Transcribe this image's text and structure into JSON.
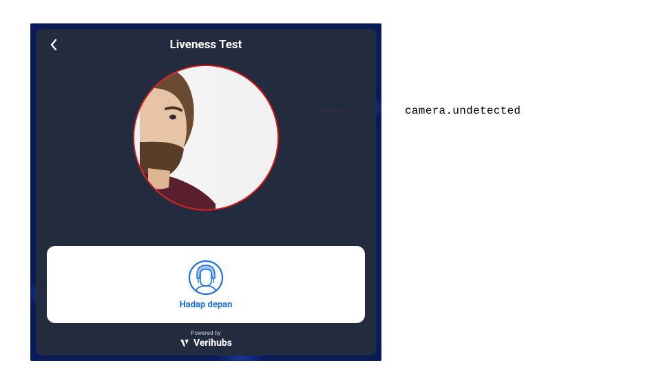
{
  "header": {
    "title": "Liveness Test"
  },
  "camera": {
    "state": "undetected",
    "ring_color": "#d41919"
  },
  "instruction": {
    "label": "Hadap depan",
    "icon_name": "face-front-icon"
  },
  "footer": {
    "powered_by": "Powered by",
    "brand": "Verihubs"
  },
  "annotation": {
    "text": "camera.undetected"
  }
}
